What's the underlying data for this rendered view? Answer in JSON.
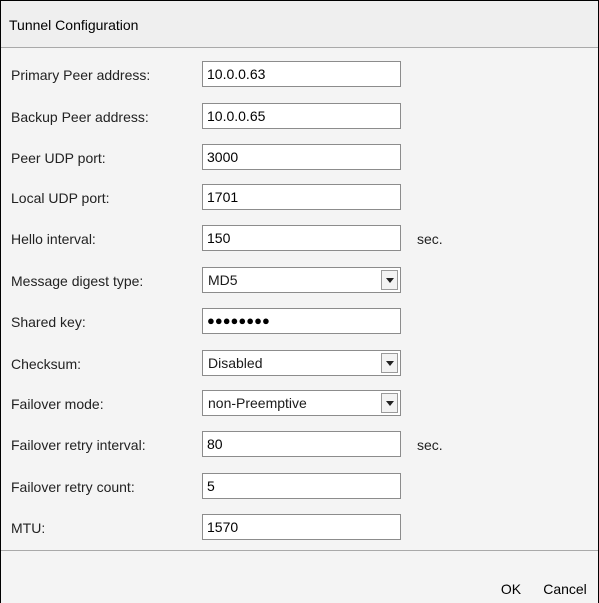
{
  "dialog": {
    "title": "Tunnel Configuration"
  },
  "fields": {
    "primary_peer": {
      "label": "Primary Peer address:",
      "value": "10.0.0.63"
    },
    "backup_peer": {
      "label": "Backup Peer address:",
      "value": "10.0.0.65"
    },
    "peer_udp_port": {
      "label": "Peer UDP port:",
      "value": "3000"
    },
    "local_udp_port": {
      "label": "Local UDP port:",
      "value": "1701"
    },
    "hello_interval": {
      "label": "Hello interval:",
      "value": "150",
      "unit": "sec."
    },
    "message_digest": {
      "label": "Message digest type:",
      "value": "MD5"
    },
    "shared_key": {
      "label": "Shared key:",
      "value": "●●●●●●●●"
    },
    "checksum": {
      "label": "Checksum:",
      "value": "Disabled"
    },
    "failover_mode": {
      "label": "Failover mode:",
      "value": "non-Preemptive"
    },
    "failover_retry_interval": {
      "label": "Failover retry interval:",
      "value": "80",
      "unit": "sec."
    },
    "failover_retry_count": {
      "label": "Failover retry count:",
      "value": "5"
    },
    "mtu": {
      "label": "MTU:",
      "value": "1570"
    }
  },
  "footer": {
    "ok_label": "OK",
    "cancel_label": "Cancel"
  }
}
